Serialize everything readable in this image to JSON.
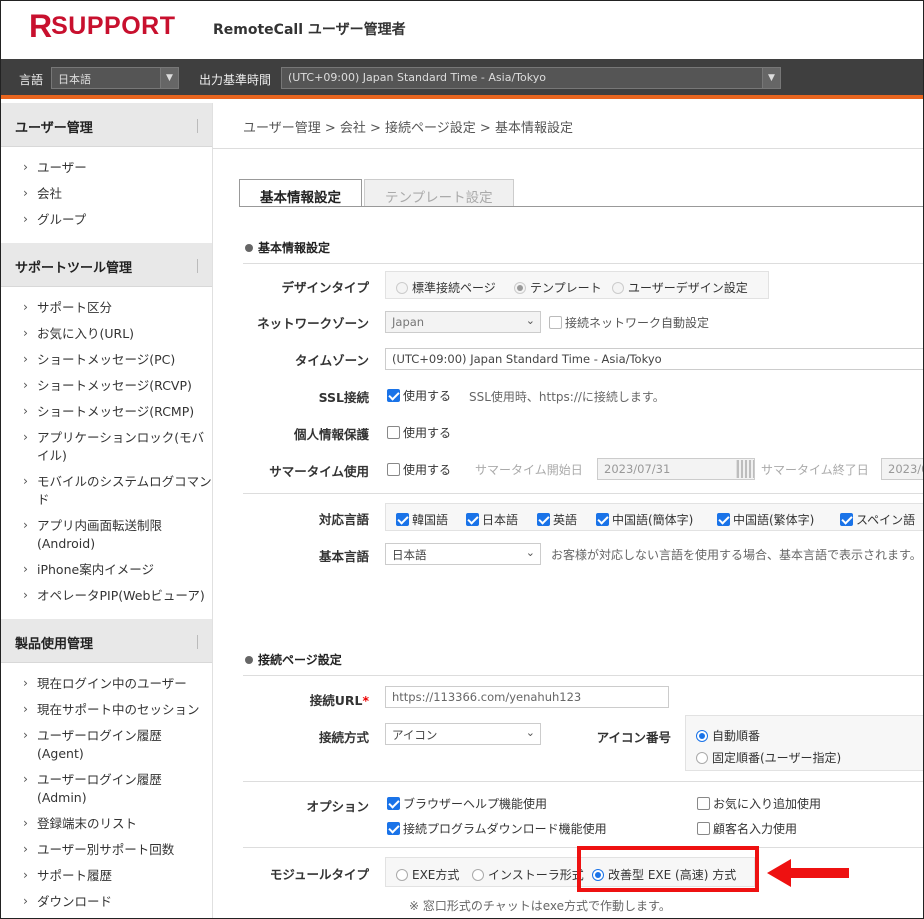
{
  "brand": {
    "logo_r": "R",
    "logo_text": "SUPPORT",
    "app_title": "RemoteCall ユーザー管理者"
  },
  "settings": {
    "language_label": "言語",
    "language_value": "日本語",
    "timezone_label": "出力基準時間",
    "timezone_value": "(UTC+09:00) Japan Standard Time - Asia/Tokyo"
  },
  "sidebar": {
    "sections": [
      {
        "title": "ユーザー管理",
        "items": [
          "ユーザー",
          "会社",
          "グループ"
        ]
      },
      {
        "title": "サポートツール管理",
        "items": [
          "サポート区分",
          "お気に入り(URL)",
          "ショートメッセージ(PC)",
          "ショートメッセージ(RCVP)",
          "ショートメッセージ(RCMP)",
          "アプリケーションロック(モバイル)",
          "モバイルのシステムログコマンド",
          "アプリ内画面転送制限 (Android)",
          "iPhone案内イメージ",
          "オペレータPIP(Webビューア)"
        ]
      },
      {
        "title": "製品使用管理",
        "items": [
          "現在ログイン中のユーザー",
          "現在サポート中のセッション",
          "ユーザーログイン履歴 (Agent)",
          "ユーザーログイン履歴 (Admin)",
          "登録端末のリスト",
          "ユーザー別サポート回数",
          "サポート履歴",
          "ダウンロード"
        ]
      }
    ]
  },
  "breadcrumb": "ユーザー管理 > 会社 > 接続ページ設定 > 基本情報設定",
  "tabs": {
    "basic": "基本情報設定",
    "template": "テンプレート設定"
  },
  "basic": {
    "section_title": "基本情報設定",
    "design_label": "デザインタイプ",
    "design_opts": [
      "標準接続ページ",
      "テンプレート",
      "ユーザーデザイン設定"
    ],
    "network_label": "ネットワークゾーン",
    "network_value": "Japan",
    "network_auto": "接続ネットワーク自動設定",
    "tz_label": "タイムゾーン",
    "tz_value": "(UTC+09:00) Japan Standard Time - Asia/Tokyo",
    "ssl_label": "SSL接続",
    "ssl_use": "使用する",
    "ssl_note": "SSL使用時、https://に接続します。",
    "privacy_label": "個人情報保護",
    "privacy_use": "使用する",
    "summer_label": "サマータイム使用",
    "summer_use": "使用する",
    "summer_start_label": "サマータイム開始日",
    "summer_start": "2023/07/31",
    "summer_end_label": "サマータイム終了日",
    "summer_end": "2023/0",
    "lang_label": "対応言語",
    "langs": [
      "韓国語",
      "日本語",
      "英語",
      "中国語(簡体字)",
      "中国語(繁体字)",
      "スペイン語"
    ],
    "baselang_label": "基本言語",
    "baselang_value": "日本語",
    "baselang_note": "お客様が対応しない言語を使用する場合、基本言語で表示されます。"
  },
  "connect": {
    "section_title": "接続ページ設定",
    "url_label": "接続URL",
    "url_required": "*",
    "url_value": "https://113366.com/yenahuh123",
    "method_label": "接続方式",
    "method_value": "アイコン",
    "iconno_label": "アイコン番号",
    "iconno_opts": [
      "自動順番",
      "固定順番(ユーザー指定)"
    ],
    "option_label": "オプション",
    "options": [
      "ブラウザーヘルプ機能使用",
      "お気に入り追加使用",
      "接続プログラムダウンロード機能使用",
      "顧客名入力使用"
    ],
    "module_label": "モジュールタイプ",
    "module_opts": [
      "EXE方式",
      "インストーラ形式",
      "改善型 EXE (高速) 方式"
    ],
    "module_note": "※ 窓口形式のチャットはexe方式で作動します。"
  },
  "colors": {
    "brand": "#c8102e",
    "accent": "#e8651f",
    "highlight": "#ee1111"
  }
}
